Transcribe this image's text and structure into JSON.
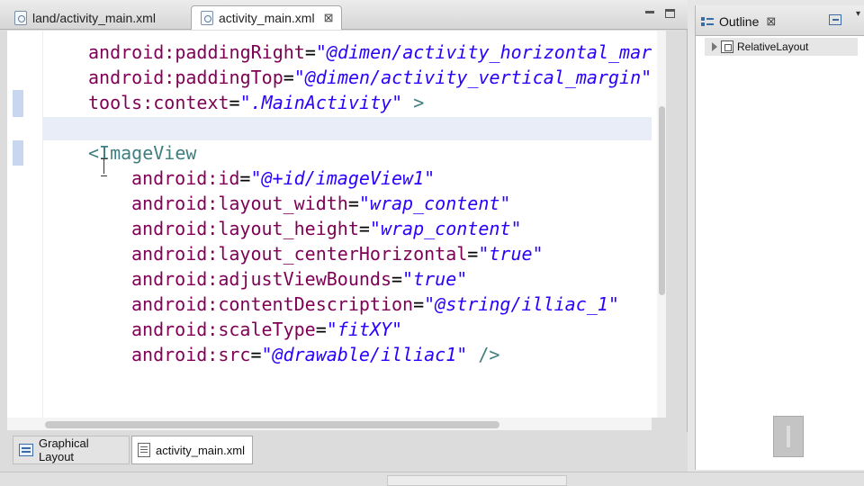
{
  "editor": {
    "tabs": [
      {
        "label": "land/activity_main.xml",
        "active": false
      },
      {
        "label": "activity_main.xml",
        "active": true,
        "close": "⊠"
      }
    ],
    "code_lines": [
      {
        "indent": 0,
        "attr": "android:paddingRight",
        "value": "\"@dimen/activity_horizontal_mar"
      },
      {
        "indent": 0,
        "attr": "android:paddingTop",
        "value": "\"@dimen/activity_vertical_margin\""
      },
      {
        "indent": 0,
        "attr": "tools:context",
        "value": "\".MainActivity\"",
        "suffix": " >"
      },
      {
        "indent": 0,
        "empty": true
      },
      {
        "indent": 0,
        "tag": "<ImageView"
      },
      {
        "indent": 1,
        "attr": "android:id",
        "value": "\"@+id/imageView1\""
      },
      {
        "indent": 1,
        "attr": "android:layout_width",
        "value": "\"wrap_content\""
      },
      {
        "indent": 1,
        "attr": "android:layout_height",
        "value": "\"wrap_content\""
      },
      {
        "indent": 1,
        "attr": "android:layout_centerHorizontal",
        "value": "\"true\""
      },
      {
        "indent": 1,
        "attr": "android:adjustViewBounds",
        "value": "\"true\""
      },
      {
        "indent": 1,
        "attr": "android:contentDescription",
        "value": "\"@string/illiac_1\""
      },
      {
        "indent": 1,
        "attr": "android:scaleType",
        "value": "\"fitXY\""
      },
      {
        "indent": 1,
        "attr": "android:src",
        "value": "\"@drawable/illiac1\"",
        "suffix": " />"
      }
    ],
    "bottom_tabs": [
      {
        "label": "Graphical Layout",
        "active": false
      },
      {
        "label": "activity_main.xml",
        "active": true
      }
    ]
  },
  "outline": {
    "title": "Outline",
    "close": "⊠",
    "menu": "▾",
    "tree": [
      {
        "label": "RelativeLayout",
        "expanded": false
      }
    ]
  },
  "colors": {
    "attribute": "#7f0055",
    "value": "#2a00ff",
    "tag": "#3f7f7f",
    "current_line": "#e8edf7"
  }
}
